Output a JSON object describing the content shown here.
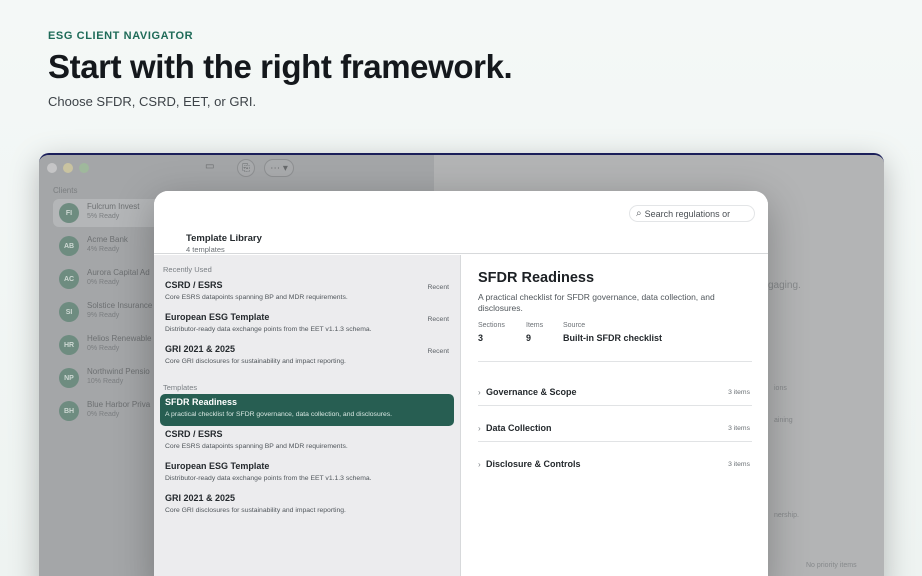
{
  "hero": {
    "eyebrow": "ESG CLIENT NAVIGATOR",
    "headline": "Start with the right framework.",
    "subhead": "Choose SFDR, CSRD, EET, or GRI."
  },
  "background_app": {
    "clients_label": "Clients",
    "clients": [
      {
        "initials": "FI",
        "name": "Fulcrum Invest",
        "ready": "5% Ready"
      },
      {
        "initials": "AB",
        "name": "Acme Bank",
        "ready": "4% Ready"
      },
      {
        "initials": "AC",
        "name": "Aurora Capital Ad",
        "ready": "0% Ready"
      },
      {
        "initials": "SI",
        "name": "Solstice Insurance",
        "ready": "9% Ready"
      },
      {
        "initials": "HR",
        "name": "Helios Renewable",
        "ready": "0% Ready"
      },
      {
        "initials": "NP",
        "name": "Northwind Pensio",
        "ready": "10% Ready"
      },
      {
        "initials": "BH",
        "name": "Blue Harbor Priva",
        "ready": "0% Ready"
      }
    ],
    "ghost_texts": {
      "gaging": "gaging.",
      "ions": "ions",
      "aining": "aining",
      "nership": "nership.",
      "no_priority": "No priority items"
    }
  },
  "sheet": {
    "search_placeholder": "Search regulations or",
    "library_title": "Template Library",
    "library_count": "4 templates",
    "recent_label": "Recently Used",
    "templates_label": "Templates",
    "recent": [
      {
        "name": "CSRD / ESRS",
        "desc": "Core ESRS datapoints spanning BP and MDR requirements.",
        "badge": "Recent"
      },
      {
        "name": "European ESG Template",
        "desc": "Distributor-ready data exchange points from the EET v1.1.3 schema.",
        "badge": "Recent"
      },
      {
        "name": "GRI 2021 & 2025",
        "desc": "Core GRI disclosures for sustainability and impact reporting.",
        "badge": "Recent"
      }
    ],
    "templates": [
      {
        "name": "SFDR Readiness",
        "desc": "A practical checklist for SFDR governance, data collection, and disclosures."
      },
      {
        "name": "CSRD / ESRS",
        "desc": "Core ESRS datapoints spanning BP and MDR requirements."
      },
      {
        "name": "European ESG Template",
        "desc": "Distributor-ready data exchange points from the EET v1.1.3 schema."
      },
      {
        "name": "GRI 2021 & 2025",
        "desc": "Core GRI disclosures for sustainability and impact reporting."
      }
    ],
    "detail": {
      "title": "SFDR Readiness",
      "description": "A practical checklist for SFDR governance, data collection, and disclosures.",
      "sections_label": "Sections",
      "sections_value": "3",
      "items_label": "Items",
      "items_value": "9",
      "source_label": "Source",
      "source_value": "Built-in SFDR checklist",
      "groups": [
        {
          "name": "Governance & Scope",
          "count": "3 items"
        },
        {
          "name": "Data Collection",
          "count": "3 items"
        },
        {
          "name": "Disclosure & Controls",
          "count": "3 items"
        }
      ]
    }
  }
}
